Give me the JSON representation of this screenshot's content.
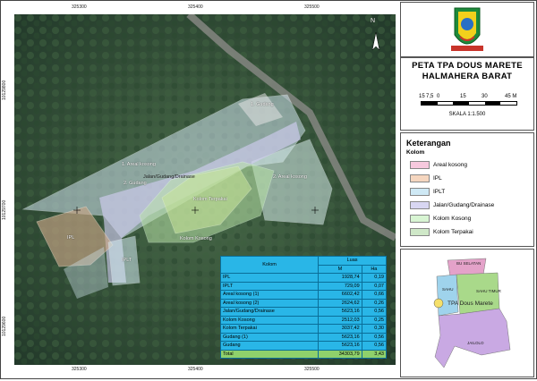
{
  "map": {
    "ticks_x": [
      "325300",
      "325400",
      "325500"
    ],
    "ticks_y": [
      "10129800",
      "10129700",
      "10129600"
    ],
    "north": "N",
    "labels": {
      "gudang1": "1. Gudang",
      "areal1": "1. Areal kosong",
      "gudang2": "2. Gudang",
      "jalan": "Jalan/Gudang/Drainase",
      "areal2": "2. Areal kosong",
      "kolom_terpakai": "Kolom Terpakai",
      "kolom_kosong": "Kolom Kosong",
      "ipl": "IPL",
      "iplt": "IPLT"
    }
  },
  "table": {
    "col_kolom": "Kolom",
    "col_luas": "Luas",
    "col_m": "M",
    "col_ha": "Ha",
    "rows": [
      {
        "name": "IPL",
        "m": "1928,74",
        "ha": "0,19"
      },
      {
        "name": "IPLT",
        "m": "729,09",
        "ha": "0,07"
      },
      {
        "name": "Areal kosong (1)",
        "m": "6602,42",
        "ha": "0,66"
      },
      {
        "name": "Areal kosong  (2)",
        "m": "2624,62",
        "ha": "0,26"
      },
      {
        "name": "Jalan/Gudang/Drainase",
        "m": "5623,16",
        "ha": "0,56"
      },
      {
        "name": "Kolom Kosong",
        "m": "2512,03",
        "ha": "0,25"
      },
      {
        "name": "Kolom Terpakai",
        "m": "3037,42",
        "ha": "0,30"
      },
      {
        "name": "Gudang (1)",
        "m": "5623,16",
        "ha": "0,56"
      },
      {
        "name": "Gudang",
        "m": "5623,16",
        "ha": "0,56"
      }
    ],
    "total": {
      "name": "Total",
      "m": "34303,79",
      "ha": "3,43"
    }
  },
  "title": {
    "line1": "PETA TPA DOUS MARETE",
    "line2": "HALMAHERA BARAT",
    "scale_ticks": [
      "15",
      "7,5",
      "0",
      "15",
      "30",
      "45 M"
    ],
    "scale_ratio": "SKALA 1:1.500"
  },
  "legend": {
    "title": "Keterangan",
    "subtitle": "Kolom",
    "items": [
      {
        "label": "Areal kosong",
        "color": "#f7c9de"
      },
      {
        "label": "IPL",
        "color": "#f5d6bf"
      },
      {
        "label": "IPLT",
        "color": "#cfe9f5"
      },
      {
        "label": "Jalan/Gudang/Drainase",
        "color": "#d8d6f2"
      },
      {
        "label": "Kolom Kosong",
        "color": "#d8f5d3"
      },
      {
        "label": "Kolom Terpakai",
        "color": "#cfe8c8"
      }
    ]
  },
  "inset": {
    "labels": {
      "bu_selatan": "BU SELATAN",
      "sahu": "SAHU",
      "sahu_timur": "SAHU TIMUR",
      "jailolo": "JAILOLO",
      "point": "TPA Dous Marete"
    }
  }
}
